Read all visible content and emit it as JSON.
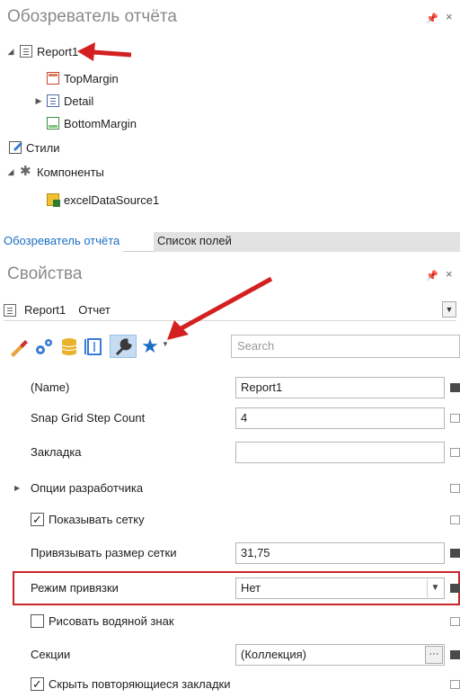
{
  "explorer": {
    "title": "Обозреватель отчёта",
    "pin": "ᵗ",
    "close": "×",
    "tree": {
      "report": "Report1",
      "top_margin": "TopMargin",
      "detail": "Detail",
      "bottom_margin": "BottomMargin",
      "styles": "Стили",
      "components": "Компоненты",
      "data_source": "excelDataSource1"
    }
  },
  "tabs": {
    "explorer_tab": "Обозреватель отчёта",
    "fields_tab": "Список полей"
  },
  "properties": {
    "title": "Свойства",
    "selected_object": "Report1",
    "selected_type": "Отчет",
    "search_placeholder": "Search",
    "rows": {
      "name_label": "(Name)",
      "name_value": "Report1",
      "snap_grid_label": "Snap Grid Step Count",
      "snap_grid_value": "4",
      "bookmark_label": "Закладка",
      "bookmark_value": "",
      "dev_options_label": "Опции разработчика",
      "show_grid_label": "Показывать сетку",
      "grid_size_label": "Привязывать размер сетки",
      "grid_size_value": "31,75",
      "snap_mode_label": "Режим привязки",
      "snap_mode_value": "Нет",
      "watermark_label": "Рисовать водяной знак",
      "sections_label": "Секции",
      "sections_value": "(Коллекция)",
      "hide_bookmarks_label": "Скрыть повторяющиеся закладки"
    }
  },
  "icons": {
    "pin": "pin-icon",
    "close": "close-icon",
    "appearance": "brush-icon",
    "behavior": "gears-icon",
    "data": "database-icon",
    "layout": "layout-icon",
    "tasks": "wrench-icon",
    "favorites": "star-icon"
  },
  "colors": {
    "accent": "#1a6ec2",
    "highlight": "#c8262c",
    "arrow": "#d42020",
    "selected_tool": "#c5dcf2"
  }
}
